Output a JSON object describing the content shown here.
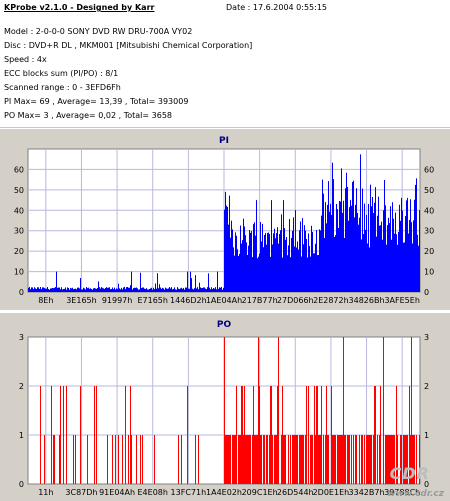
{
  "info": {
    "title": "KProbe v2.1.0 - Designed by Karr",
    "date": "Date : 17.6.2004 0:55:15",
    "lines": [
      "Model : 2-0-0-0 SONY   DVD RW DRU-700A  VY02",
      "Disc : DVD+R DL , MKM001 [Mitsubishi Chemical Corporation]",
      "Speed : 4x",
      "ECC blocks sum (PI/PO) : 8/1",
      "Scanned range : 0 - 3EFD6Fh",
      "PI Max= 69 , Average= 13,39 , Total= 393009",
      "PO Max= 3 , Average= 0,02 , Total= 3658"
    ]
  },
  "watermark": {
    "logo": "CDR",
    "site": "www.cdr.cz"
  },
  "colors": {
    "pi": "#0000ff",
    "po": "#ff0000",
    "plot_bg": "#ffffff",
    "grid": "#b8b8e0",
    "panel_bg": "#d4d0c8",
    "title": "#000080"
  },
  "chart_data": [
    {
      "type": "area",
      "title": "PI",
      "xlabel": "",
      "ylabel": "",
      "x_ticks": [
        "8Eh",
        "3E165h",
        "91997h",
        "E7165h",
        "1446D2h",
        "1AE04Ah",
        "217B77h",
        "27D066h",
        "2E2872h",
        "34826Bh",
        "3AFE5Eh"
      ],
      "y_ticks": [
        0,
        10,
        20,
        30,
        40,
        50,
        60
      ],
      "ylim": [
        0,
        70
      ],
      "grid": true,
      "series": [
        {
          "segments": [
            {
              "x_range": [
                0.0,
                0.5
              ],
              "typical": 2,
              "peak": 10
            },
            {
              "x_range": [
                0.5,
                0.52
              ],
              "typical": 40,
              "peak": 64
            },
            {
              "x_range": [
                0.52,
                0.75
              ],
              "typical": 30,
              "peak": 45
            },
            {
              "x_range": [
                0.75,
                0.86
              ],
              "typical": 45,
              "peak": 69
            },
            {
              "x_range": [
                0.86,
                1.0
              ],
              "typical": 38,
              "peak": 66
            }
          ]
        }
      ]
    },
    {
      "type": "bar",
      "title": "PO",
      "xlabel": "",
      "ylabel": "",
      "x_ticks": [
        "11h",
        "3C87Dh",
        "91E04Ah",
        "E4E08h",
        "13FC71h",
        "1A4E02h",
        "209C1Eh",
        "26D544h",
        "2D0E1Eh",
        "3342B7h",
        "39788Ch"
      ],
      "y_ticks": [
        0,
        1,
        2,
        3
      ],
      "ylim": [
        0,
        3
      ],
      "grid": true,
      "series": [
        {
          "segments": [
            {
              "x_range": [
                0.0,
                0.5
              ],
              "density": 0.18,
              "max": 2
            },
            {
              "x_range": [
                0.5,
                1.0
              ],
              "density": 0.75,
              "max": 3
            }
          ]
        }
      ]
    }
  ]
}
